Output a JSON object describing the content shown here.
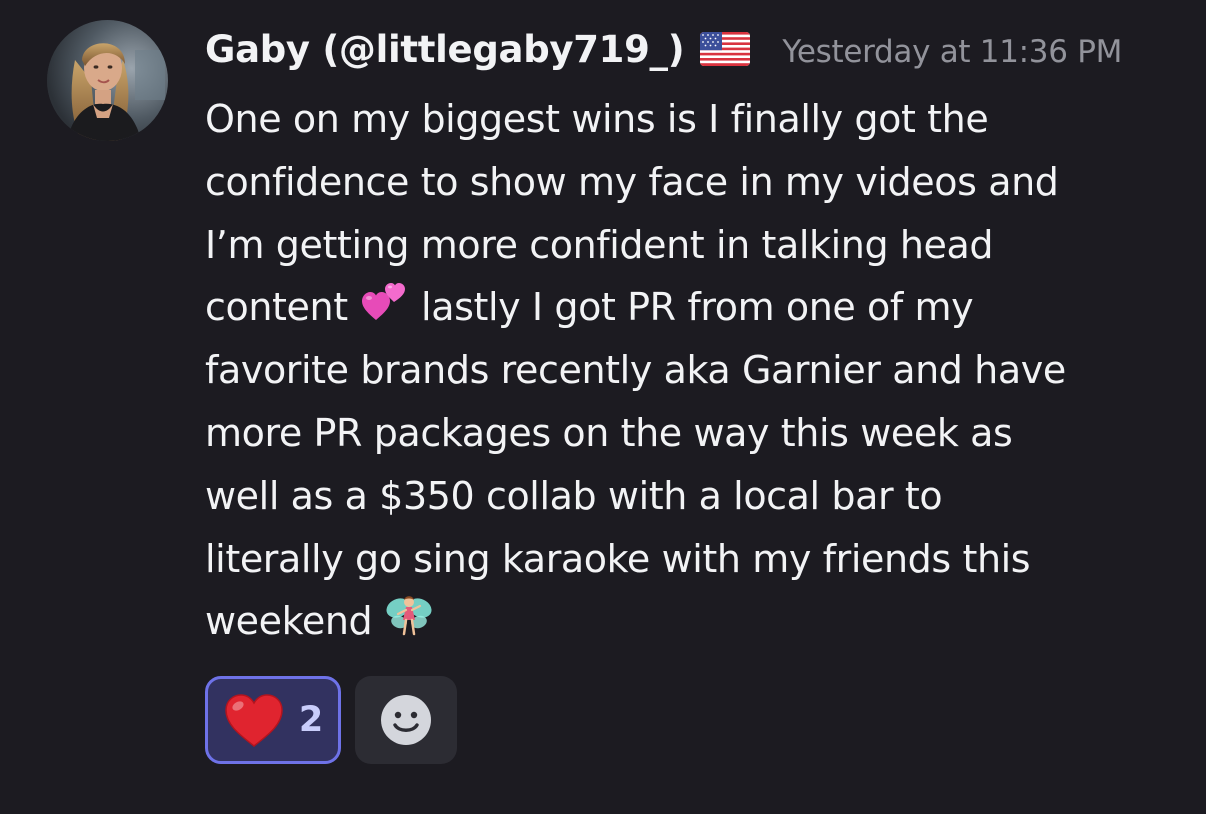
{
  "message": {
    "author": "Gaby (@littlegaby719_)",
    "flag_icon": "us-flag-icon",
    "timestamp": "Yesterday at 11:36 PM",
    "lines": [
      {
        "before": "One on my biggest wins is I finally got the",
        "emoji": "",
        "after": ""
      },
      {
        "before": "confidence to show my face in my videos and",
        "emoji": "",
        "after": ""
      },
      {
        "before": "I’m getting more confident in talking head",
        "emoji": "",
        "after": ""
      },
      {
        "before": "content ",
        "emoji": "two-hearts-emoji",
        "after": " lastly I got PR from one of my"
      },
      {
        "before": "favorite brands recently aka Garnier and have",
        "emoji": "",
        "after": ""
      },
      {
        "before": "more PR packages on the way this week as",
        "emoji": "",
        "after": ""
      },
      {
        "before": "well as a $350 collab with a local bar to",
        "emoji": "",
        "after": ""
      },
      {
        "before": "literally go sing karaoke with my friends this",
        "emoji": "",
        "after": ""
      },
      {
        "before": "weekend ",
        "emoji": "fairy-emoji",
        "after": ""
      }
    ]
  },
  "reactions": [
    {
      "emoji": "red-heart-emoji",
      "count": "2",
      "selected": true
    }
  ],
  "add_reaction_icon": "add-reaction-smiley-icon",
  "colors": {
    "background": "#1c1b21",
    "text": "#f2f3f5",
    "timestamp": "#92939b",
    "reaction_border": "#6e72e8",
    "reaction_bg": "#323260",
    "reaction_count": "#c9cdfb"
  }
}
